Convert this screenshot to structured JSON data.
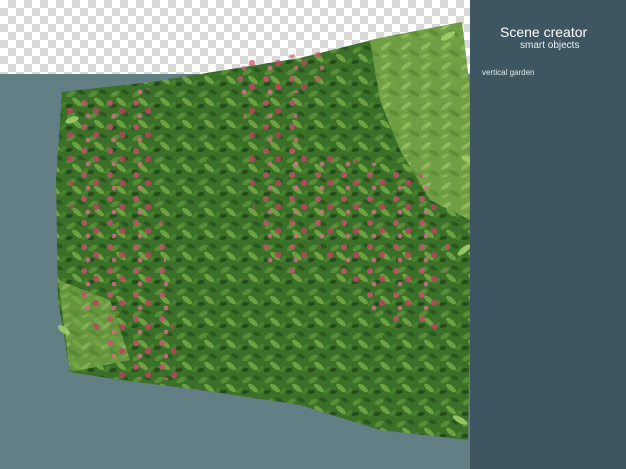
{
  "panel": {
    "title": "Scene creator",
    "subtitle": "smart objects",
    "caption": "vertical garden"
  },
  "colors": {
    "panel_bg": "#3e5661",
    "scene_bg": "#627f86",
    "foliage_dark": "#2f5e25",
    "foliage_mid": "#4f8a33",
    "foliage_light": "#8fc25a",
    "flower": "#d45a73"
  }
}
